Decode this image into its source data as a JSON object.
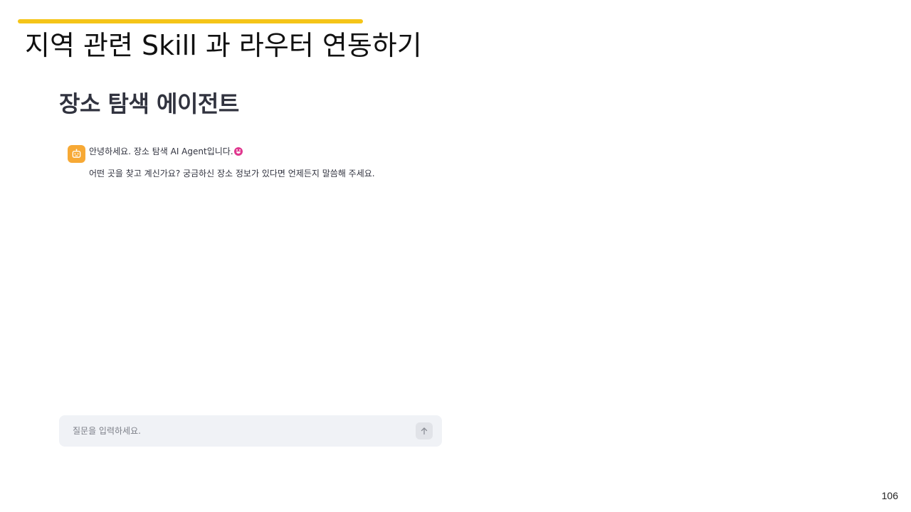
{
  "slide": {
    "title": "지역 관련 Skill 과 라우터 연동하기",
    "accent_color": "#f5c518",
    "page_number": "106"
  },
  "app": {
    "title": "장소 탐색 에이전트"
  },
  "chat": {
    "messages": [
      {
        "role": "assistant",
        "avatar_icon": "robot-face-icon",
        "avatar_color": "#f7a935",
        "line1": "안녕하세요. 장소 탐색 AI Agent입니다.",
        "line1_emoji": "smiling-face-with-tongue-emoji",
        "line2": "어떤 곳을 찾고 계신가요? 궁금하신 장소 정보가 있다면 언제든지 말씀해 주세요."
      }
    ],
    "input": {
      "placeholder": "질문을 입력하세요.",
      "value": "",
      "send_icon": "arrow-up-icon"
    }
  }
}
